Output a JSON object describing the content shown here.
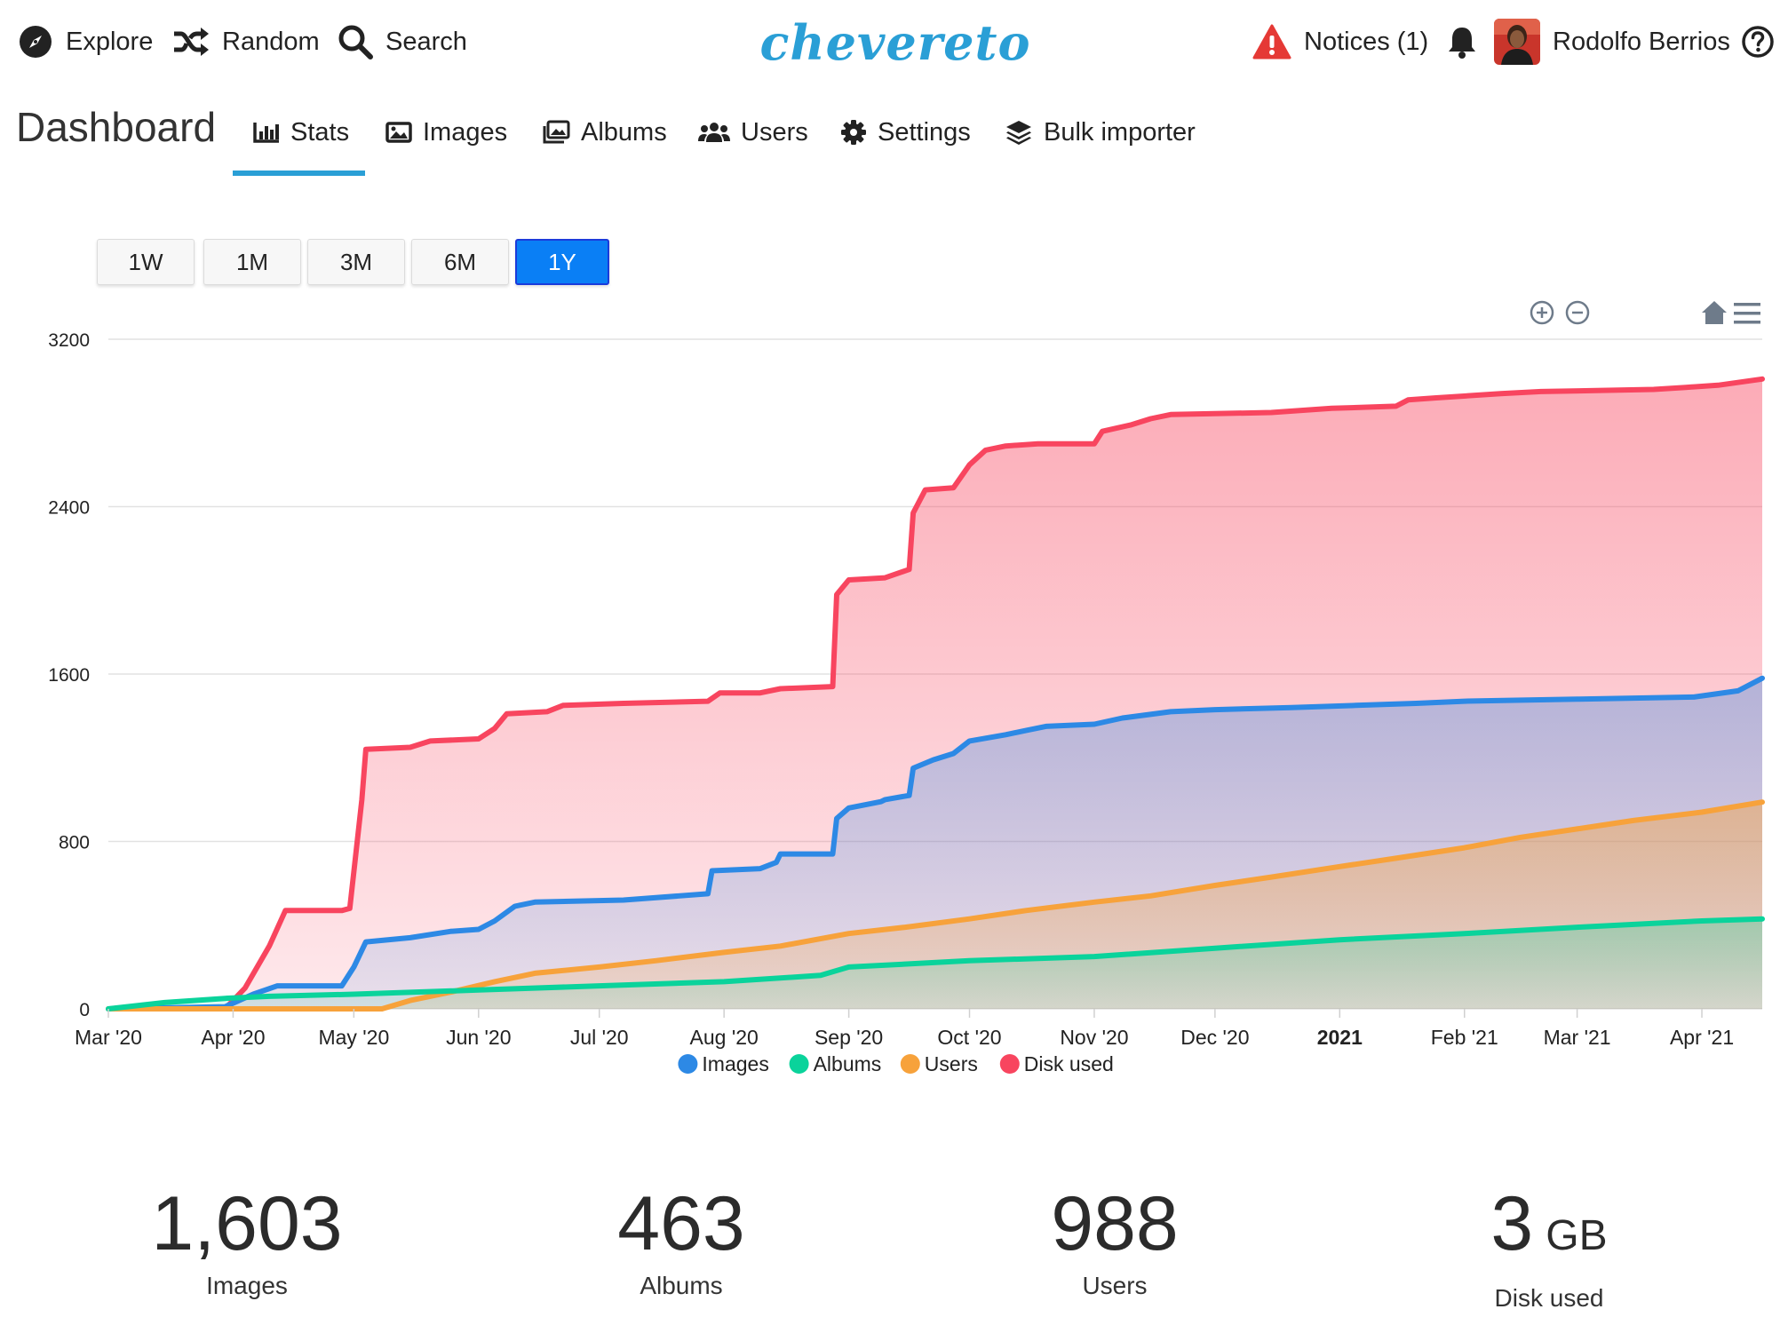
{
  "header": {
    "explore": "Explore",
    "random": "Random",
    "search": "Search",
    "logo": "chevereto",
    "notices": "Notices (1)",
    "user_name": "Rodolfo Berrios"
  },
  "dashboard": {
    "title": "Dashboard",
    "tabs": [
      {
        "label": "Stats",
        "icon": "bar-chart-icon",
        "active": true
      },
      {
        "label": "Images",
        "icon": "image-icon"
      },
      {
        "label": "Albums",
        "icon": "albums-icon"
      },
      {
        "label": "Users",
        "icon": "users-icon"
      },
      {
        "label": "Settings",
        "icon": "gear-icon"
      },
      {
        "label": "Bulk importer",
        "icon": "layers-icon"
      }
    ]
  },
  "range_buttons": [
    {
      "label": "1W"
    },
    {
      "label": "1M"
    },
    {
      "label": "3M"
    },
    {
      "label": "6M"
    },
    {
      "label": "1Y",
      "active": true
    }
  ],
  "chart_data": {
    "type": "area",
    "ylim": [
      0,
      3200
    ],
    "y_ticks": [
      "3200",
      "2400",
      "1600",
      "800",
      "0"
    ],
    "x_ticks": [
      "Mar '20",
      "Apr '20",
      "May '20",
      "Jun '20",
      "Jul '20",
      "Aug '20",
      "Sep '20",
      "Oct '20",
      "Nov '20",
      "Dec '20",
      "2021",
      "Feb '21",
      "Mar '21",
      "Apr '21"
    ],
    "x_range": [
      "2020-03-01",
      "2021-04-16"
    ],
    "grid": true,
    "legend": "bottom-center",
    "series": [
      {
        "name": "Disk used",
        "color": "#f8455f",
        "points": [
          [
            "2020-03-01",
            0
          ],
          [
            "2020-03-30",
            0
          ],
          [
            "2020-04-04",
            100
          ],
          [
            "2020-04-10",
            300
          ],
          [
            "2020-04-14",
            470
          ],
          [
            "2020-04-28",
            470
          ],
          [
            "2020-04-30",
            480
          ],
          [
            "2020-05-03",
            1000
          ],
          [
            "2020-05-04",
            1240
          ],
          [
            "2020-05-15",
            1250
          ],
          [
            "2020-05-20",
            1280
          ],
          [
            "2020-06-01",
            1290
          ],
          [
            "2020-06-05",
            1340
          ],
          [
            "2020-06-08",
            1410
          ],
          [
            "2020-06-18",
            1420
          ],
          [
            "2020-06-22",
            1450
          ],
          [
            "2020-07-07",
            1460
          ],
          [
            "2020-07-28",
            1470
          ],
          [
            "2020-07-31",
            1510
          ],
          [
            "2020-08-10",
            1510
          ],
          [
            "2020-08-15",
            1530
          ],
          [
            "2020-08-28",
            1540
          ],
          [
            "2020-08-29",
            1980
          ],
          [
            "2020-09-01",
            2050
          ],
          [
            "2020-09-10",
            2060
          ],
          [
            "2020-09-16",
            2100
          ],
          [
            "2020-09-17",
            2370
          ],
          [
            "2020-09-20",
            2480
          ],
          [
            "2020-09-27",
            2490
          ],
          [
            "2020-10-01",
            2600
          ],
          [
            "2020-10-05",
            2670
          ],
          [
            "2020-10-10",
            2690
          ],
          [
            "2020-10-18",
            2700
          ],
          [
            "2020-11-01",
            2700
          ],
          [
            "2020-11-03",
            2760
          ],
          [
            "2020-11-10",
            2790
          ],
          [
            "2020-11-15",
            2820
          ],
          [
            "2020-11-20",
            2840
          ],
          [
            "2020-12-15",
            2850
          ],
          [
            "2020-12-30",
            2870
          ],
          [
            "2021-01-15",
            2880
          ],
          [
            "2021-01-18",
            2910
          ],
          [
            "2021-01-25",
            2920
          ],
          [
            "2021-02-10",
            2940
          ],
          [
            "2021-02-20",
            2950
          ],
          [
            "2021-03-20",
            2960
          ],
          [
            "2021-03-28",
            2970
          ],
          [
            "2021-04-05",
            2980
          ],
          [
            "2021-04-16",
            3010
          ]
        ]
      },
      {
        "name": "Images",
        "color": "#2d89e5",
        "points": [
          [
            "2020-03-01",
            0
          ],
          [
            "2020-03-30",
            10
          ],
          [
            "2020-04-06",
            70
          ],
          [
            "2020-04-12",
            110
          ],
          [
            "2020-04-28",
            110
          ],
          [
            "2020-05-01",
            200
          ],
          [
            "2020-05-04",
            320
          ],
          [
            "2020-05-15",
            340
          ],
          [
            "2020-05-25",
            370
          ],
          [
            "2020-06-01",
            380
          ],
          [
            "2020-06-05",
            420
          ],
          [
            "2020-06-10",
            490
          ],
          [
            "2020-06-15",
            510
          ],
          [
            "2020-07-07",
            520
          ],
          [
            "2020-07-28",
            550
          ],
          [
            "2020-07-29",
            660
          ],
          [
            "2020-08-10",
            670
          ],
          [
            "2020-08-14",
            700
          ],
          [
            "2020-08-15",
            740
          ],
          [
            "2020-08-28",
            740
          ],
          [
            "2020-08-29",
            910
          ],
          [
            "2020-09-01",
            960
          ],
          [
            "2020-09-09",
            990
          ],
          [
            "2020-09-10",
            1000
          ],
          [
            "2020-09-16",
            1020
          ],
          [
            "2020-09-17",
            1150
          ],
          [
            "2020-09-22",
            1190
          ],
          [
            "2020-09-27",
            1220
          ],
          [
            "2020-10-01",
            1280
          ],
          [
            "2020-10-10",
            1310
          ],
          [
            "2020-10-15",
            1330
          ],
          [
            "2020-10-20",
            1350
          ],
          [
            "2020-11-01",
            1360
          ],
          [
            "2020-11-08",
            1390
          ],
          [
            "2020-11-20",
            1420
          ],
          [
            "2020-12-01",
            1430
          ],
          [
            "2020-12-20",
            1440
          ],
          [
            "2021-01-05",
            1450
          ],
          [
            "2021-01-20",
            1460
          ],
          [
            "2021-02-01",
            1470
          ],
          [
            "2021-03-01",
            1480
          ],
          [
            "2021-03-30",
            1490
          ],
          [
            "2021-04-10",
            1520
          ],
          [
            "2021-04-16",
            1580
          ]
        ]
      },
      {
        "name": "Users",
        "color": "#f7a23b",
        "points": [
          [
            "2020-03-01",
            0
          ],
          [
            "2020-04-01",
            0
          ],
          [
            "2020-05-08",
            0
          ],
          [
            "2020-05-15",
            40
          ],
          [
            "2020-05-25",
            80
          ],
          [
            "2020-06-05",
            130
          ],
          [
            "2020-06-15",
            170
          ],
          [
            "2020-07-01",
            200
          ],
          [
            "2020-07-15",
            230
          ],
          [
            "2020-08-01",
            270
          ],
          [
            "2020-08-15",
            300
          ],
          [
            "2020-09-01",
            360
          ],
          [
            "2020-09-15",
            390
          ],
          [
            "2020-10-01",
            430
          ],
          [
            "2020-10-15",
            470
          ],
          [
            "2020-11-01",
            510
          ],
          [
            "2020-11-15",
            540
          ],
          [
            "2020-12-01",
            590
          ],
          [
            "2020-12-15",
            630
          ],
          [
            "2021-01-01",
            680
          ],
          [
            "2021-01-15",
            720
          ],
          [
            "2021-02-01",
            770
          ],
          [
            "2021-02-15",
            820
          ],
          [
            "2021-03-01",
            860
          ],
          [
            "2021-03-15",
            900
          ],
          [
            "2021-04-01",
            940
          ],
          [
            "2021-04-16",
            988
          ]
        ]
      },
      {
        "name": "Albums",
        "color": "#0ad39b",
        "points": [
          [
            "2020-03-01",
            0
          ],
          [
            "2020-03-15",
            30
          ],
          [
            "2020-03-30",
            50
          ],
          [
            "2020-04-10",
            60
          ],
          [
            "2020-05-01",
            70
          ],
          [
            "2020-06-01",
            90
          ],
          [
            "2020-07-01",
            110
          ],
          [
            "2020-08-01",
            130
          ],
          [
            "2020-08-25",
            160
          ],
          [
            "2020-09-01",
            200
          ],
          [
            "2020-10-01",
            230
          ],
          [
            "2020-11-01",
            250
          ],
          [
            "2020-12-01",
            290
          ],
          [
            "2021-01-01",
            330
          ],
          [
            "2021-02-01",
            360
          ],
          [
            "2021-03-01",
            390
          ],
          [
            "2021-04-01",
            420
          ],
          [
            "2021-04-16",
            430
          ]
        ]
      }
    ],
    "legend_order": [
      "Images",
      "Albums",
      "Users",
      "Disk used"
    ]
  },
  "stats": [
    {
      "value": "1,603",
      "unit": "",
      "label": "Images"
    },
    {
      "value": "463",
      "unit": "",
      "label": "Albums"
    },
    {
      "value": "988",
      "unit": "",
      "label": "Users"
    },
    {
      "value": "3",
      "unit": "GB",
      "label": "Disk used"
    }
  ]
}
